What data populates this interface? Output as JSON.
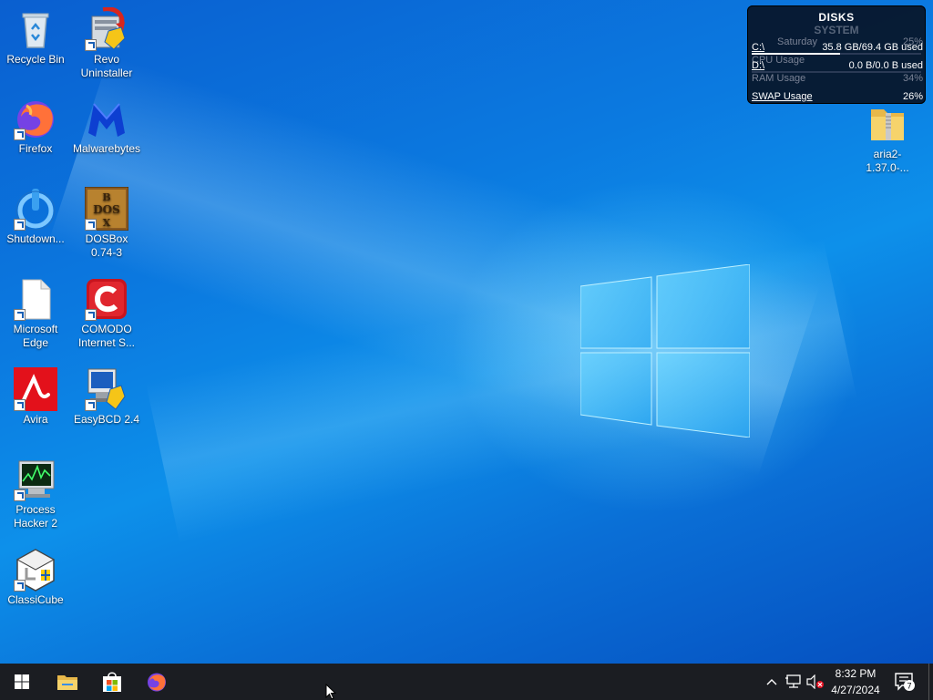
{
  "desktop": {
    "icons": [
      {
        "label": "Recycle Bin"
      },
      {
        "label": "Revo Uninstaller"
      },
      {
        "label": "Firefox"
      },
      {
        "label": "Malwarebytes"
      },
      {
        "label": "Shutdown..."
      },
      {
        "label": "DOSBox 0.74-3"
      },
      {
        "label": "Microsoft Edge"
      },
      {
        "label": "COMODO Internet S..."
      },
      {
        "label": "Avira"
      },
      {
        "label": "EasyBCD 2.4"
      },
      {
        "label": "Process Hacker 2"
      },
      {
        "label": "ClassiCube"
      },
      {
        "label": "aria2-1.37.0-..."
      }
    ]
  },
  "gadget": {
    "title": "DISKS",
    "subtitle": "SYSTEM",
    "ghost_top": "Saturday",
    "ghost_top_value": "25%",
    "rows": [
      {
        "key": "C:\\",
        "value": "35.8 GB/69.4 GB used",
        "fraction": 0.52
      },
      {
        "key": "D:\\",
        "value": "0.0 B/0.0 B used",
        "fraction": 0.0
      }
    ],
    "ghost_rows": [
      {
        "key": "CPU Usage",
        "value": "25%"
      },
      {
        "key": "RAM Usage",
        "value": "34%",
        "fraction": 0.34
      }
    ],
    "swap": {
      "key": "SWAP Usage",
      "value": "26%"
    }
  },
  "taskbar": {
    "time": "8:32 PM",
    "date": "4/27/2024",
    "notification_count": "7"
  },
  "colors": {
    "taskbar": "#1b1d22",
    "desktop_accent": "#0b7ae0"
  }
}
